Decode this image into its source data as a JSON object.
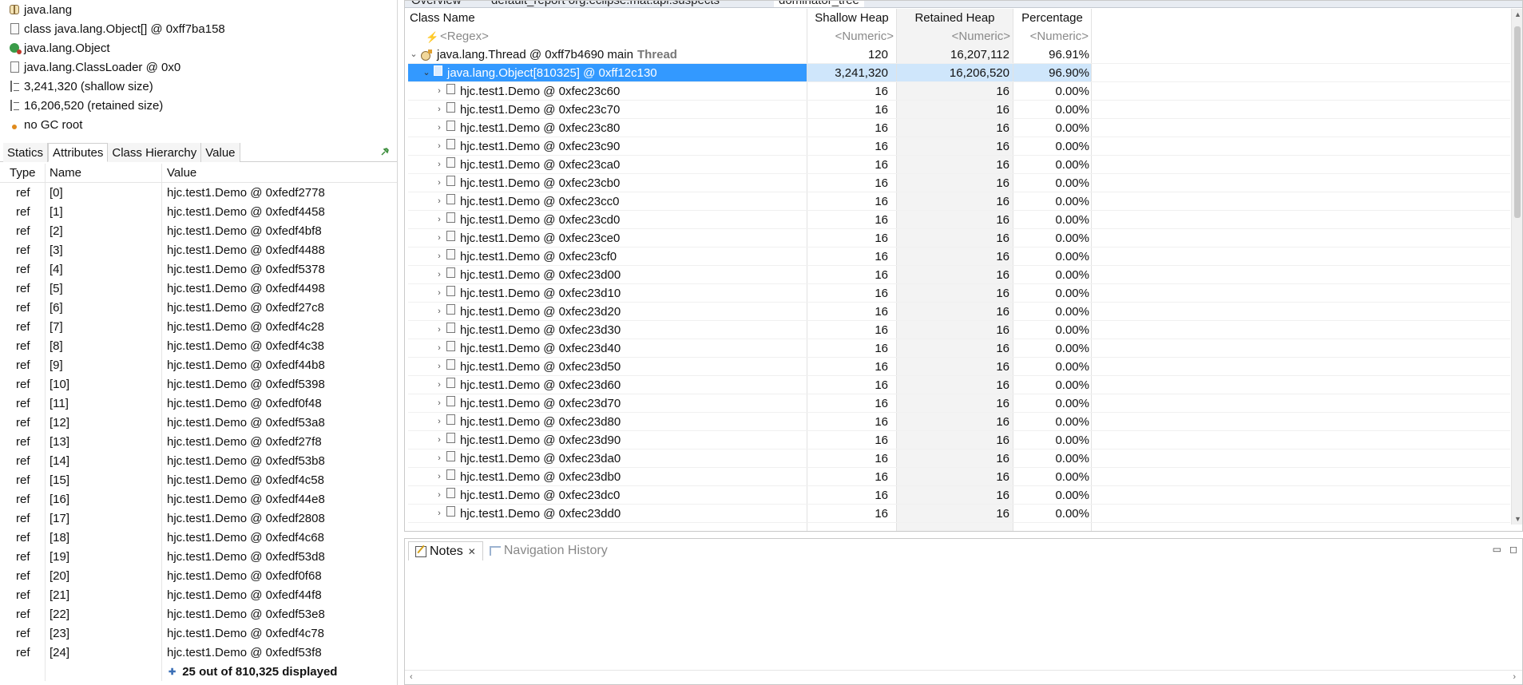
{
  "inspector": {
    "info": [
      {
        "icon": "package-icon",
        "text": "java.lang"
      },
      {
        "icon": "class-file-icon",
        "text": "class java.lang.Object[] @ 0xff7ba158"
      },
      {
        "icon": "object-class-icon",
        "text": "java.lang.Object"
      },
      {
        "icon": "classloader-icon",
        "text": "java.lang.ClassLoader @ 0x0"
      },
      {
        "icon": "shallow-size-icon",
        "text": "3,241,320 (shallow size)"
      },
      {
        "icon": "retained-size-icon",
        "text": "16,206,520 (retained size)"
      },
      {
        "icon": "gc-root-icon",
        "text": "no GC root"
      }
    ],
    "tabs": [
      "Statics",
      "Attributes",
      "Class Hierarchy",
      "Value"
    ],
    "active_tab": "Attributes",
    "columns": {
      "type": "Type",
      "name": "Name",
      "value": "Value"
    },
    "rows": [
      {
        "type": "ref",
        "name": "[0]",
        "value": "hjc.test1.Demo @ 0xfedf2778"
      },
      {
        "type": "ref",
        "name": "[1]",
        "value": "hjc.test1.Demo @ 0xfedf4458"
      },
      {
        "type": "ref",
        "name": "[2]",
        "value": "hjc.test1.Demo @ 0xfedf4bf8"
      },
      {
        "type": "ref",
        "name": "[3]",
        "value": "hjc.test1.Demo @ 0xfedf4488"
      },
      {
        "type": "ref",
        "name": "[4]",
        "value": "hjc.test1.Demo @ 0xfedf5378"
      },
      {
        "type": "ref",
        "name": "[5]",
        "value": "hjc.test1.Demo @ 0xfedf4498"
      },
      {
        "type": "ref",
        "name": "[6]",
        "value": "hjc.test1.Demo @ 0xfedf27c8"
      },
      {
        "type": "ref",
        "name": "[7]",
        "value": "hjc.test1.Demo @ 0xfedf4c28"
      },
      {
        "type": "ref",
        "name": "[8]",
        "value": "hjc.test1.Demo @ 0xfedf4c38"
      },
      {
        "type": "ref",
        "name": "[9]",
        "value": "hjc.test1.Demo @ 0xfedf44b8"
      },
      {
        "type": "ref",
        "name": "[10]",
        "value": "hjc.test1.Demo @ 0xfedf5398"
      },
      {
        "type": "ref",
        "name": "[11]",
        "value": "hjc.test1.Demo @ 0xfedf0f48"
      },
      {
        "type": "ref",
        "name": "[12]",
        "value": "hjc.test1.Demo @ 0xfedf53a8"
      },
      {
        "type": "ref",
        "name": "[13]",
        "value": "hjc.test1.Demo @ 0xfedf27f8"
      },
      {
        "type": "ref",
        "name": "[14]",
        "value": "hjc.test1.Demo @ 0xfedf53b8"
      },
      {
        "type": "ref",
        "name": "[15]",
        "value": "hjc.test1.Demo @ 0xfedf4c58"
      },
      {
        "type": "ref",
        "name": "[16]",
        "value": "hjc.test1.Demo @ 0xfedf44e8"
      },
      {
        "type": "ref",
        "name": "[17]",
        "value": "hjc.test1.Demo @ 0xfedf2808"
      },
      {
        "type": "ref",
        "name": "[18]",
        "value": "hjc.test1.Demo @ 0xfedf4c68"
      },
      {
        "type": "ref",
        "name": "[19]",
        "value": "hjc.test1.Demo @ 0xfedf53d8"
      },
      {
        "type": "ref",
        "name": "[20]",
        "value": "hjc.test1.Demo @ 0xfedf0f68"
      },
      {
        "type": "ref",
        "name": "[21]",
        "value": "hjc.test1.Demo @ 0xfedf44f8"
      },
      {
        "type": "ref",
        "name": "[22]",
        "value": "hjc.test1.Demo @ 0xfedf53e8"
      },
      {
        "type": "ref",
        "name": "[23]",
        "value": "hjc.test1.Demo @ 0xfedf4c78"
      },
      {
        "type": "ref",
        "name": "[24]",
        "value": "hjc.test1.Demo @ 0xfedf53f8"
      }
    ],
    "more_text": "25 out of 810,325 displayed"
  },
  "editor": {
    "tabs": [
      "Overview",
      "default_report  org.eclipse.mat.api:suspects",
      "dominator_tree"
    ],
    "columns": {
      "class_name": "Class Name",
      "shallow": "Shallow Heap",
      "retained": "Retained Heap",
      "percentage": "Percentage"
    },
    "filters": {
      "class_name": "<Regex>",
      "shallow": "<Numeric>",
      "retained": "<Numeric>",
      "percentage": "<Numeric>"
    },
    "thread_row": {
      "name": "java.lang.Thread @ 0xff7b4690  main",
      "tag": "Thread",
      "shallow": "120",
      "retained": "16,207,112",
      "percentage": "96.91%"
    },
    "selected_row": {
      "name": "java.lang.Object[810325] @ 0xff12c130",
      "shallow": "3,241,320",
      "retained": "16,206,520",
      "percentage": "96.90%"
    },
    "rows": [
      {
        "name": "hjc.test1.Demo @ 0xfec23c60",
        "shallow": "16",
        "retained": "16",
        "percentage": "0.00%"
      },
      {
        "name": "hjc.test1.Demo @ 0xfec23c70",
        "shallow": "16",
        "retained": "16",
        "percentage": "0.00%"
      },
      {
        "name": "hjc.test1.Demo @ 0xfec23c80",
        "shallow": "16",
        "retained": "16",
        "percentage": "0.00%"
      },
      {
        "name": "hjc.test1.Demo @ 0xfec23c90",
        "shallow": "16",
        "retained": "16",
        "percentage": "0.00%"
      },
      {
        "name": "hjc.test1.Demo @ 0xfec23ca0",
        "shallow": "16",
        "retained": "16",
        "percentage": "0.00%"
      },
      {
        "name": "hjc.test1.Demo @ 0xfec23cb0",
        "shallow": "16",
        "retained": "16",
        "percentage": "0.00%"
      },
      {
        "name": "hjc.test1.Demo @ 0xfec23cc0",
        "shallow": "16",
        "retained": "16",
        "percentage": "0.00%"
      },
      {
        "name": "hjc.test1.Demo @ 0xfec23cd0",
        "shallow": "16",
        "retained": "16",
        "percentage": "0.00%"
      },
      {
        "name": "hjc.test1.Demo @ 0xfec23ce0",
        "shallow": "16",
        "retained": "16",
        "percentage": "0.00%"
      },
      {
        "name": "hjc.test1.Demo @ 0xfec23cf0",
        "shallow": "16",
        "retained": "16",
        "percentage": "0.00%"
      },
      {
        "name": "hjc.test1.Demo @ 0xfec23d00",
        "shallow": "16",
        "retained": "16",
        "percentage": "0.00%"
      },
      {
        "name": "hjc.test1.Demo @ 0xfec23d10",
        "shallow": "16",
        "retained": "16",
        "percentage": "0.00%"
      },
      {
        "name": "hjc.test1.Demo @ 0xfec23d20",
        "shallow": "16",
        "retained": "16",
        "percentage": "0.00%"
      },
      {
        "name": "hjc.test1.Demo @ 0xfec23d30",
        "shallow": "16",
        "retained": "16",
        "percentage": "0.00%"
      },
      {
        "name": "hjc.test1.Demo @ 0xfec23d40",
        "shallow": "16",
        "retained": "16",
        "percentage": "0.00%"
      },
      {
        "name": "hjc.test1.Demo @ 0xfec23d50",
        "shallow": "16",
        "retained": "16",
        "percentage": "0.00%"
      },
      {
        "name": "hjc.test1.Demo @ 0xfec23d60",
        "shallow": "16",
        "retained": "16",
        "percentage": "0.00%"
      },
      {
        "name": "hjc.test1.Demo @ 0xfec23d70",
        "shallow": "16",
        "retained": "16",
        "percentage": "0.00%"
      },
      {
        "name": "hjc.test1.Demo @ 0xfec23d80",
        "shallow": "16",
        "retained": "16",
        "percentage": "0.00%"
      },
      {
        "name": "hjc.test1.Demo @ 0xfec23d90",
        "shallow": "16",
        "retained": "16",
        "percentage": "0.00%"
      },
      {
        "name": "hjc.test1.Demo @ 0xfec23da0",
        "shallow": "16",
        "retained": "16",
        "percentage": "0.00%"
      },
      {
        "name": "hjc.test1.Demo @ 0xfec23db0",
        "shallow": "16",
        "retained": "16",
        "percentage": "0.00%"
      },
      {
        "name": "hjc.test1.Demo @ 0xfec23dc0",
        "shallow": "16",
        "retained": "16",
        "percentage": "0.00%"
      },
      {
        "name": "hjc.test1.Demo @ 0xfec23dd0",
        "shallow": "16",
        "retained": "16",
        "percentage": "0.00%"
      }
    ]
  },
  "notes": {
    "tabs": [
      "Notes",
      "Navigation History"
    ],
    "active_tab": "Notes"
  },
  "colors": {
    "selection": "#3399ff",
    "selection_light": "#cfe6fb",
    "accent_link": "#3b6fb6"
  }
}
